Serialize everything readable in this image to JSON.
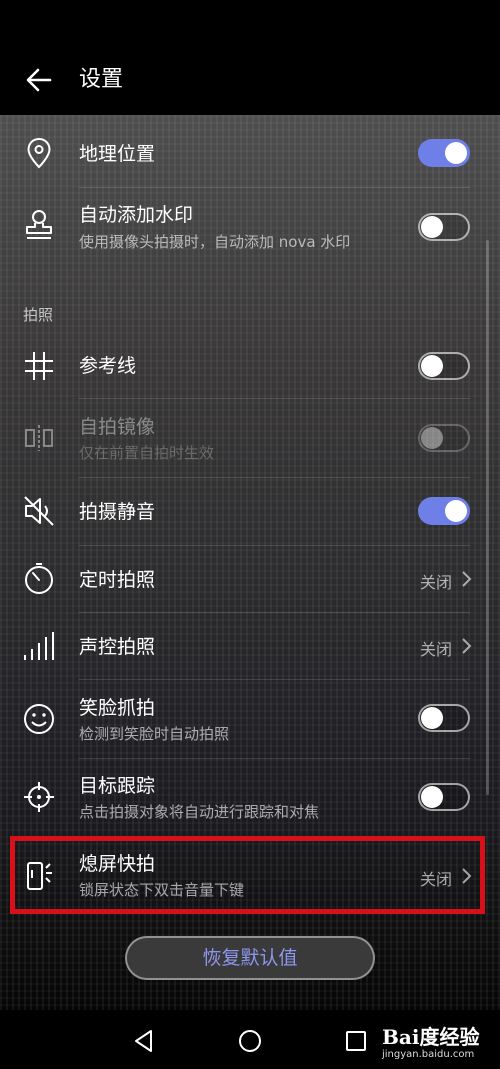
{
  "header": {
    "title": "设置"
  },
  "items": [
    {
      "label": "地理位置",
      "icon": "location-pin-icon",
      "control": "toggle",
      "state": "on"
    },
    {
      "label": "自动添加水印",
      "sub": "使用摄像头拍摄时，自动添加 nova 水印",
      "icon": "stamp-icon",
      "control": "toggle",
      "state": "off"
    },
    {
      "label": "参考线",
      "icon": "grid-icon",
      "control": "toggle",
      "state": "off"
    },
    {
      "label": "自拍镜像",
      "sub": "仅在前置自拍时生效",
      "icon": "mirror-icon",
      "control": "toggle",
      "state": "off",
      "disabled": true
    },
    {
      "label": "拍摄静音",
      "icon": "speaker-mute-icon",
      "control": "toggle",
      "state": "on"
    },
    {
      "label": "定时拍照",
      "icon": "timer-icon",
      "control": "value",
      "value": "关闭"
    },
    {
      "label": "声控拍照",
      "icon": "audio-bars-icon",
      "control": "value",
      "value": "关闭"
    },
    {
      "label": "笑脸抓拍",
      "sub": "检测到笑脸时自动拍照",
      "icon": "smile-icon",
      "control": "toggle",
      "state": "off"
    },
    {
      "label": "目标跟踪",
      "sub": "点击拍摄对象将自动进行跟踪和对焦",
      "icon": "crosshair-icon",
      "control": "toggle",
      "state": "off"
    },
    {
      "label": "熄屏快拍",
      "sub": "锁屏状态下双击音量下键",
      "icon": "phone-button-icon",
      "control": "value",
      "value": "关闭"
    }
  ],
  "section": {
    "photo": "拍照"
  },
  "restore_label": "恢复默认值",
  "watermark": {
    "main": "Bai度经验",
    "sub": "jingyan.baidu.com"
  },
  "colors": {
    "accent": "#6f7fe8",
    "highlight": "#d8101a",
    "restore_text": "#8e97f0"
  }
}
